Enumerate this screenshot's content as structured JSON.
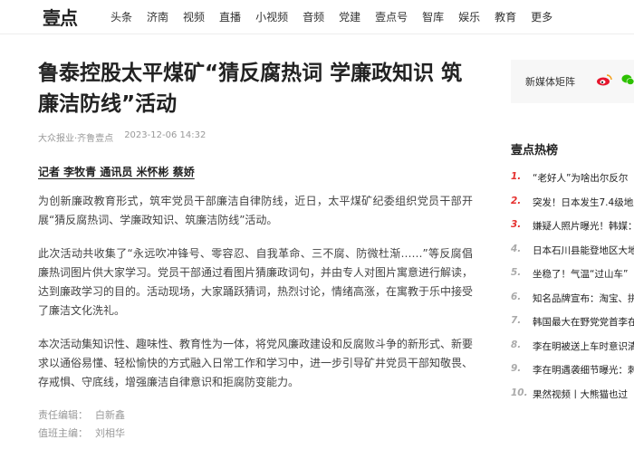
{
  "header": {
    "logo": "壹点",
    "nav": [
      "头条",
      "济南",
      "视频",
      "直播",
      "小视频",
      "音频",
      "党建",
      "壹点号",
      "智库",
      "娱乐",
      "教育",
      "更多"
    ]
  },
  "article": {
    "title": "鲁泰控股太平煤矿“猜反腐热词 学廉政知识 筑廉洁防线”活动",
    "source": "大众报业·齐鲁壹点",
    "time": "2023-12-06 14:32",
    "byline": "记者 李牧青 通讯员 米怀彬 蔡娇",
    "paragraphs": [
      "为创新廉政教育形式，筑牢党员干部廉洁自律防线，近日，太平煤矿纪委组织党员干部开展“猜反腐热词、学廉政知识、筑廉洁防线”活动。",
      "此次活动共收集了“永远吹冲锋号、零容忍、自我革命、三不腐、防微杜渐……”等反腐倡廉热词图片供大家学习。党员干部通过看图片猜廉政词句，并由专人对图片寓意进行解读，达到廉政学习的目的。活动现场，大家踊跃猜词，热烈讨论，情绪高涨，在寓教于乐中接受了廉洁文化洗礼。",
      "本次活动集知识性、趣味性、教育性为一体，将党风廉政建设和反腐败斗争的新形式、新要求以通俗易懂、轻松愉快的方式融入日常工作和学习中，进一步引导矿井党员干部知敬畏、存戒惧、守底线，增强廉洁自律意识和拒腐防变能力。"
    ],
    "editors": [
      {
        "key": "责任编辑：",
        "value": "白新鑫"
      },
      {
        "key": "值班主编：",
        "value": "刘相华"
      }
    ]
  },
  "sidebar": {
    "matrix_label": "新媒体矩阵",
    "icons": [
      "weibo-icon",
      "wechat-icon"
    ],
    "hot_title": "壹点热榜",
    "hot_items": [
      {
        "num": "1.",
        "text": "“老好人”为啥出尔反尔"
      },
      {
        "num": "2.",
        "text": "突发！日本发生7.4级地震"
      },
      {
        "num": "3.",
        "text": "嫌疑人照片曝光！韩媒：韩"
      },
      {
        "num": "4.",
        "text": "日本石川县能登地区大地"
      },
      {
        "num": "5.",
        "text": "坐稳了！气温“过山车”"
      },
      {
        "num": "6.",
        "text": "知名品牌宣布：淘宝、拼"
      },
      {
        "num": "7.",
        "text": "韩国最大在野党党首李在"
      },
      {
        "num": "8.",
        "text": "李在明被送上车时意识清"
      },
      {
        "num": "9.",
        "text": "李在明遇袭细节曝光：刺"
      },
      {
        "num": "10.",
        "text": "果然视频丨大熊猫也过"
      }
    ],
    "accent_color": "#e5312f"
  }
}
